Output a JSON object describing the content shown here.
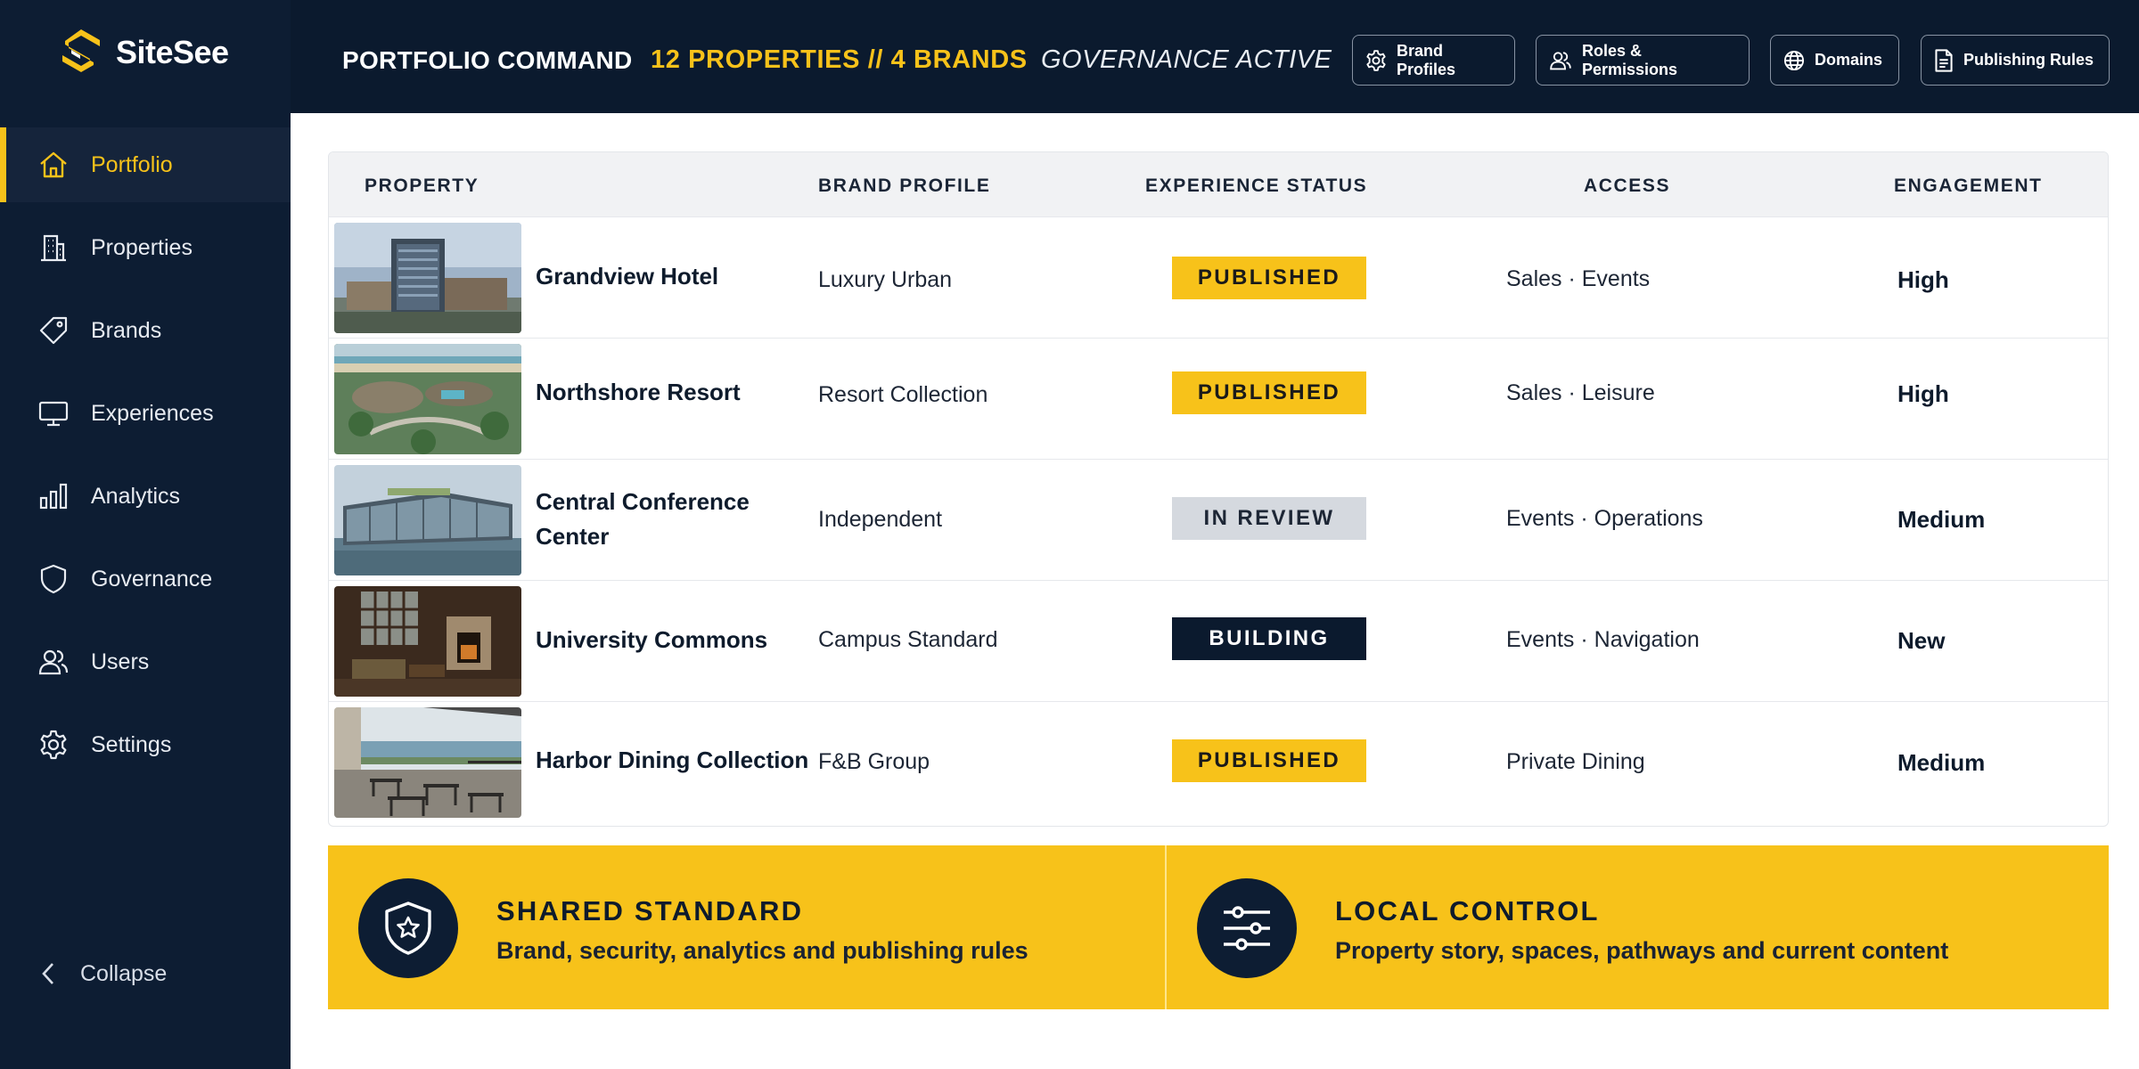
{
  "brand": {
    "name": "SiteSee"
  },
  "sidebar": {
    "items": [
      {
        "label": "Portfolio",
        "icon": "home-icon",
        "active": true
      },
      {
        "label": "Properties",
        "icon": "building-icon"
      },
      {
        "label": "Brands",
        "icon": "tag-icon"
      },
      {
        "label": "Experiences",
        "icon": "monitor-icon"
      },
      {
        "label": "Analytics",
        "icon": "bar-chart-icon"
      },
      {
        "label": "Governance",
        "icon": "shield-icon"
      },
      {
        "label": "Users",
        "icon": "users-icon"
      },
      {
        "label": "Settings",
        "icon": "gear-icon"
      }
    ],
    "collapse_label": "Collapse"
  },
  "header": {
    "title": "PORTFOLIO COMMAND",
    "count": "12 PROPERTIES // 4 BRANDS",
    "governance": "GOVERNANCE ACTIVE",
    "buttons": [
      {
        "label": "Brand Profiles",
        "icon": "gear-icon"
      },
      {
        "label": "Roles & Permissions",
        "icon": "users-icon"
      },
      {
        "label": "Domains",
        "icon": "globe-icon"
      },
      {
        "label": "Publishing Rules",
        "icon": "document-icon"
      }
    ]
  },
  "table": {
    "columns": [
      "PROPERTY",
      "BRAND PROFILE",
      "EXPERIENCE STATUS",
      "ACCESS",
      "ENGAGEMENT"
    ],
    "rows": [
      {
        "property": "Grandview Hotel",
        "brand": "Luxury Urban",
        "status": "PUBLISHED",
        "access": "Sales · Events",
        "engagement": "High"
      },
      {
        "property": "Northshore Resort",
        "brand": "Resort Collection",
        "status": "PUBLISHED",
        "access": "Sales · Leisure",
        "engagement": "High"
      },
      {
        "property": "Central Conference Center",
        "brand": "Independent",
        "status": "IN REVIEW",
        "access": "Events · Operations",
        "engagement": "Medium"
      },
      {
        "property": "University Commons",
        "brand": "Campus Standard",
        "status": "BUILDING",
        "access": "Events · Navigation",
        "engagement": "New"
      },
      {
        "property": "Harbor Dining Collection",
        "brand": "F&B Group",
        "status": "PUBLISHED",
        "access": "Private Dining",
        "engagement": "Medium"
      }
    ]
  },
  "panels": {
    "shared": {
      "title": "SHARED STANDARD",
      "subtitle": "Brand, security, analytics and publishing rules",
      "icon": "shield-star-icon"
    },
    "local": {
      "title": "LOCAL CONTROL",
      "subtitle": "Property story, spaces, pathways and current content",
      "icon": "sliders-icon"
    }
  },
  "colors": {
    "navy": "#0b1a2e",
    "accent": "#f7c21a",
    "review": "#d5d9df"
  }
}
